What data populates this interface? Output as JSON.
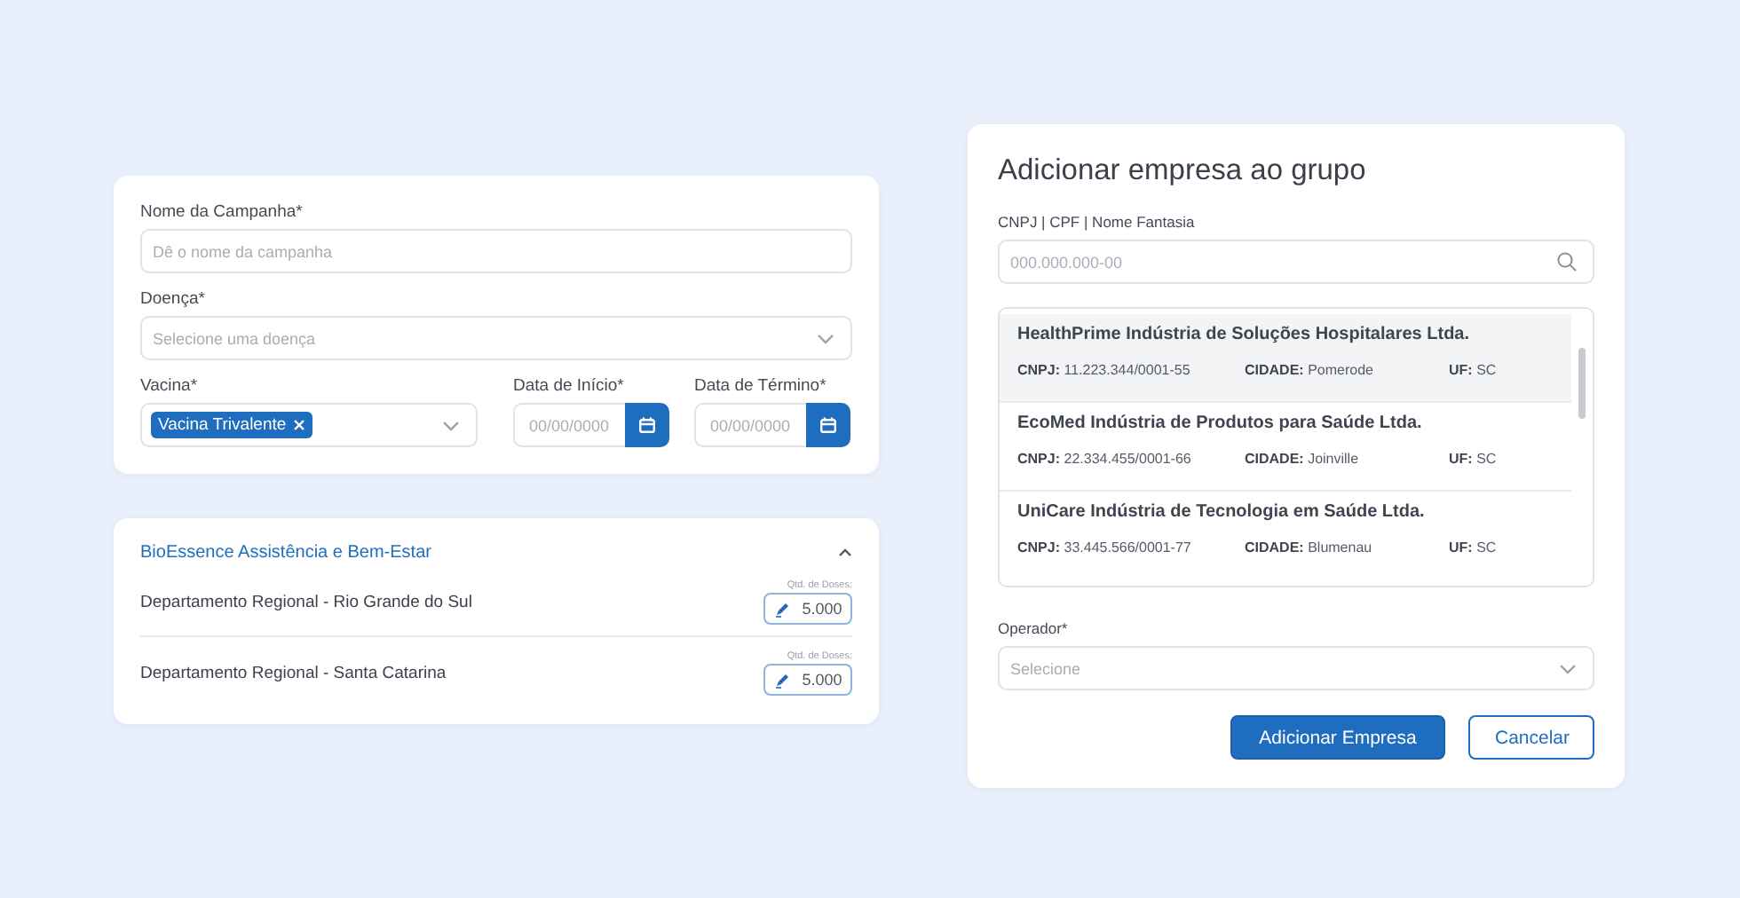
{
  "campaign_form": {
    "name_field": {
      "label": "Nome da Campanha*",
      "placeholder": "Dê o nome da campanha"
    },
    "disease_field": {
      "label": "Doença*",
      "placeholder": "Selecione uma doença"
    },
    "vaccine_field": {
      "label": "Vacina*",
      "tags": [
        "Vacina Trivalente"
      ]
    },
    "start_date": {
      "label": "Data de Início*",
      "placeholder": "00/00/0000"
    },
    "end_date": {
      "label": "Data de Término*",
      "placeholder": "00/00/0000"
    }
  },
  "group_panel": {
    "title": "BioEssence Assistência e Bem-Estar",
    "expanded": true,
    "rows": [
      {
        "name": "Departamento Regional - Rio Grande do Sul",
        "doses_label": "Qtd. de Doses:",
        "doses": "5.000"
      },
      {
        "name": "Departamento Regional - Santa Catarina",
        "doses_label": "Qtd. de Doses:",
        "doses": "5.000"
      }
    ]
  },
  "dialog": {
    "title": "Adicionar empresa ao grupo",
    "search": {
      "label": "CNPJ | CPF | Nome Fantasia",
      "placeholder": "000.000.000-00"
    },
    "results": [
      {
        "name": "HealthPrime Indústria de Soluções Hospitalares Ltda.",
        "selected": true,
        "fields": [
          {
            "label": "CNPJ:",
            "value": "11.223.344/0001-55"
          },
          {
            "label": "CIDADE:",
            "value": "Pomerode"
          },
          {
            "label": "UF:",
            "value": "SC"
          }
        ]
      },
      {
        "name": "EcoMed Indústria de Produtos para Saúde Ltda.",
        "selected": false,
        "fields": [
          {
            "label": "CNPJ:",
            "value": "22.334.455/0001-66"
          },
          {
            "label": "CIDADE:",
            "value": "Joinville"
          },
          {
            "label": "UF:",
            "value": "SC"
          }
        ]
      },
      {
        "name": "UniCare Indústria de Tecnologia em Saúde Ltda.",
        "selected": false,
        "fields": [
          {
            "label": "CNPJ:",
            "value": "33.445.566/0001-77"
          },
          {
            "label": "CIDADE:",
            "value": "Blumenau"
          },
          {
            "label": "UF:",
            "value": "SC"
          }
        ]
      }
    ],
    "operator": {
      "label": "Operador*",
      "placeholder": "Selecione"
    },
    "buttons": [
      {
        "label": "Adicionar Empresa",
        "kind": "primary"
      },
      {
        "label": "Cancelar",
        "kind": "secondary"
      }
    ]
  }
}
